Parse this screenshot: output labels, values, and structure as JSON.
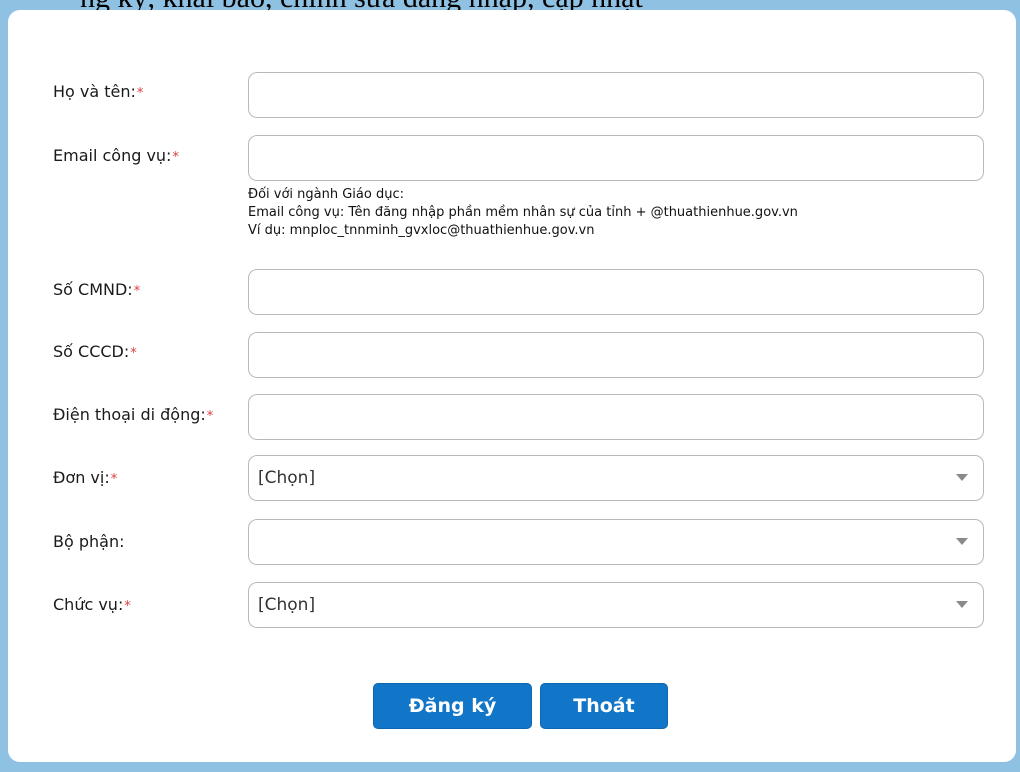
{
  "top_text": "ng ký, khai báo, chỉnh sửa đăng nhập, cập nhật",
  "form": {
    "required_mark": "*",
    "fields": [
      {
        "label": "Họ và tên:",
        "value": ""
      },
      {
        "label": "Email công vụ:",
        "value": ""
      },
      {
        "label": "Số CMND:",
        "value": ""
      },
      {
        "label": "Số CCCD:",
        "value": ""
      },
      {
        "label": "Điện thoại di động:",
        "value": ""
      }
    ],
    "email_hint": [
      "Đối với ngành Giáo dục:",
      "Email công vụ: Tên đăng nhập phần mềm nhân sự của tỉnh + @thuathienhue.gov.vn",
      "Ví dụ: mnploc_tnnminh_gvxloc@thuathienhue.gov.vn"
    ],
    "selects": [
      {
        "label": "Đơn vị:",
        "value": "[Chọn]",
        "required": true
      },
      {
        "label": "Bộ phận:",
        "value": "",
        "required": false
      },
      {
        "label": "Chức vụ:",
        "value": "[Chọn]",
        "required": true
      }
    ]
  },
  "buttons": {
    "register": "Đăng ký",
    "exit": "Thoát"
  },
  "colors": {
    "background": "#8fc1e3",
    "required": "#e03a3a",
    "button": "#1276c8"
  },
  "icons": {
    "dropdown": "triangle-down"
  }
}
